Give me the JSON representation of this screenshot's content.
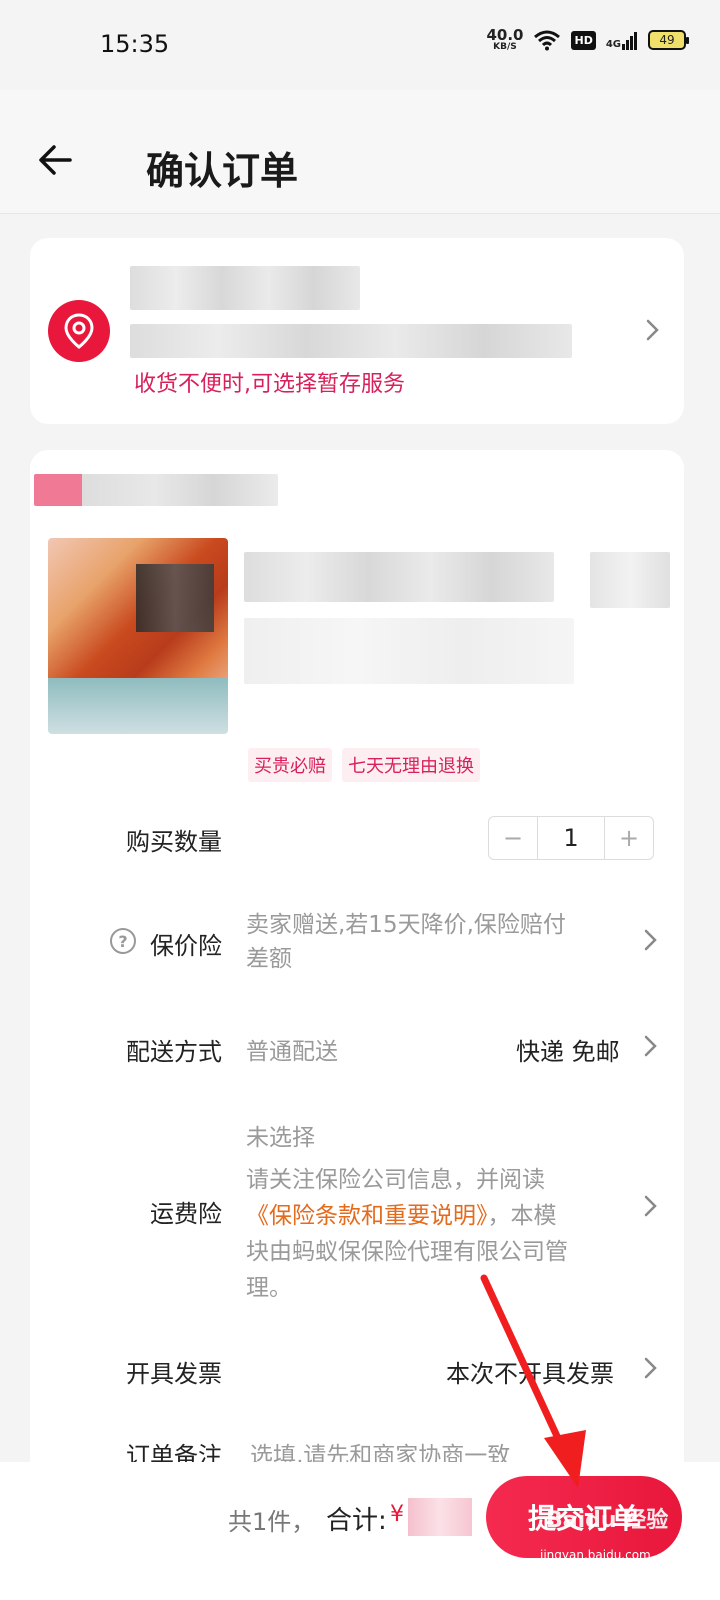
{
  "status_bar": {
    "time": "15:35",
    "net_speed_value": "40.0",
    "net_speed_unit": "KB/S",
    "hd_badge": "HD",
    "signal_label": "4G",
    "battery": "49"
  },
  "header": {
    "title": "确认订单",
    "back_icon": "arrow-left-icon"
  },
  "address": {
    "icon": "location-pin-icon",
    "hint": "收货不便时,可选择暂存服务",
    "accent_color": "#e8173b"
  },
  "product": {
    "tags": [
      "买贵必赔",
      "七天无理由退换"
    ]
  },
  "rows": {
    "quantity_label": "购买数量",
    "quantity_minus": "−",
    "quantity_value": "1",
    "quantity_plus": "+",
    "price_protect_label": "保价险",
    "price_protect_help": "?",
    "price_protect_value_line1": "卖家赠送,若15天降价,保险赔付",
    "price_protect_value_line2": "差额",
    "delivery_label": "配送方式",
    "delivery_value": "普通配送",
    "delivery_option": "快递 免邮",
    "shipping_ins_label": "运费险",
    "shipping_ins_status": "未选择",
    "shipping_ins_desc1": "请关注保险公司信息，并阅读",
    "shipping_ins_link": "《保险条款和重要说明》",
    "shipping_ins_desc2": "，本模",
    "shipping_ins_desc3": "块由蚂蚁保保险代理有限公司管",
    "shipping_ins_desc4": "理。",
    "invoice_label": "开具发票",
    "invoice_value": "本次不开具发票",
    "remark_label": "订单备注",
    "remark_placeholder": "选填,请先和商家协商一致"
  },
  "bottom_bar": {
    "count": "共1件，",
    "total_label": "合计:",
    "currency": "¥",
    "submit_label": "提交订单"
  },
  "watermark": {
    "brand": "Baidu 经验",
    "url": "jingyan.baidu.com"
  }
}
